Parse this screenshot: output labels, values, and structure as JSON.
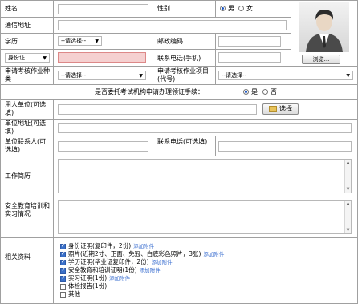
{
  "fields": {
    "name_label": "姓名",
    "gender_label": "性别",
    "gender_male": "男",
    "gender_female": "女",
    "address_label": "通信地址",
    "education_label": "学历",
    "education_select": "--请选择--",
    "postcode_label": "邮政编码",
    "idtype_select": "身份证",
    "phone_label": "联系电话(手机)",
    "exam_type_label": "申请考核作业种类",
    "exam_type_select": "--请选择--",
    "exam_item_label": "申请考核作业项目(代号)",
    "exam_item_select": "--请选择--",
    "entrust_question": "是否委托考试机构申请办理领证手续：",
    "entrust_yes": "是",
    "entrust_no": "否",
    "employer_label": "用人单位(可选填)",
    "select_button": "选择",
    "unit_address_label": "单位地址(可选填)",
    "unit_contact_label": "单位联系人(可选填)",
    "contact_phone_label": "联系电话(可选填)",
    "work_history_label": "工作简历",
    "safety_edu_label": "安全教育培训和实习情况",
    "materials_label": "相关资料",
    "browse_button": "浏览..."
  },
  "materials": [
    {
      "text": "身份证明(复印件，2份)",
      "add": "添加附件",
      "checked": true
    },
    {
      "text": "照片(近期2寸、正面、免冠、白底彩色照片，3张)",
      "add": "添加附件",
      "checked": true
    },
    {
      "text": "学历证明(毕业证复印件，2份)",
      "add": "添加附件",
      "checked": true
    },
    {
      "text": "安全教育和培训证明(1份)",
      "add": "添加附件",
      "checked": true
    },
    {
      "text": "实习证明(1份)",
      "add": "添加附件",
      "checked": true
    },
    {
      "text": "体检报告(1份)",
      "add": "",
      "checked": false
    },
    {
      "text": "其他",
      "add": "",
      "checked": false
    }
  ],
  "colors": {
    "border": "#a0a0a0",
    "accent": "#3b6fd0",
    "error_input": "#f5d0d0"
  }
}
